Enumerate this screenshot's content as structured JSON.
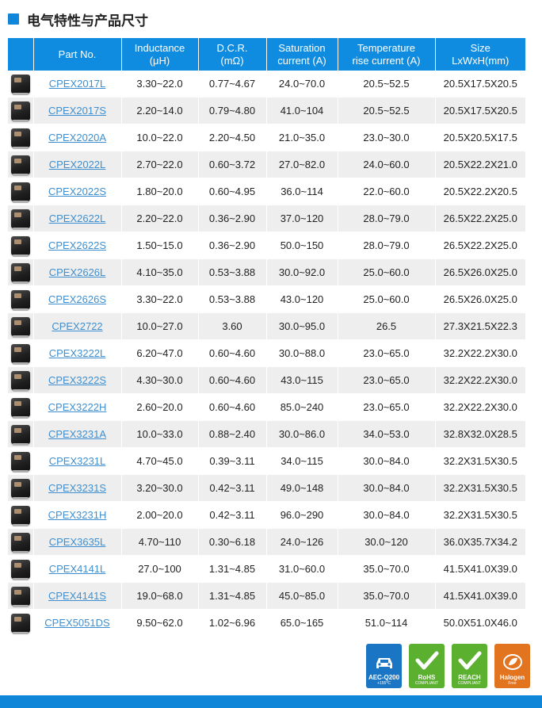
{
  "page": {
    "title": "电气特性与产品尺寸"
  },
  "table": {
    "headers": [
      "",
      "Part No.",
      "Inductance\n(μH)",
      "D.C.R.\n(mΩ)",
      "Saturation\ncurrent (A)",
      "Temperature\nrise current (A)",
      "Size\nLxWxH(mm)"
    ],
    "rows": [
      [
        "CPEX2017L",
        "3.30~22.0",
        "0.77~4.67",
        "24.0~70.0",
        "20.5~52.5",
        "20.5X17.5X20.5"
      ],
      [
        "CPEX2017S",
        "2.20~14.0",
        "0.79~4.80",
        "41.0~104",
        "20.5~52.5",
        "20.5X17.5X20.5"
      ],
      [
        "CPEX2020A",
        "10.0~22.0",
        "2.20~4.50",
        "21.0~35.0",
        "23.0~30.0",
        "20.5X20.5X17.5"
      ],
      [
        "CPEX2022L",
        "2.70~22.0",
        "0.60~3.72",
        "27.0~82.0",
        "24.0~60.0",
        "20.5X22.2X21.0"
      ],
      [
        "CPEX2022S",
        "1.80~20.0",
        "0.60~4.95",
        "36.0~114",
        "22.0~60.0",
        "20.5X22.2X20.5"
      ],
      [
        "CPEX2622L",
        "2.20~22.0",
        "0.36~2.90",
        "37.0~120",
        "28.0~79.0",
        "26.5X22.2X25.0"
      ],
      [
        "CPEX2622S",
        "1.50~15.0",
        "0.36~2.90",
        "50.0~150",
        "28.0~79.0",
        "26.5X22.2X25.0"
      ],
      [
        "CPEX2626L",
        "4.10~35.0",
        "0.53~3.88",
        "30.0~92.0",
        "25.0~60.0",
        "26.5X26.0X25.0"
      ],
      [
        "CPEX2626S",
        "3.30~22.0",
        "0.53~3.88",
        "43.0~120",
        "25.0~60.0",
        "26.5X26.0X25.0"
      ],
      [
        "CPEX2722",
        "10.0~27.0",
        "3.60",
        "30.0~95.0",
        "26.5",
        "27.3X21.5X22.3"
      ],
      [
        "CPEX3222L",
        "6.20~47.0",
        "0.60~4.60",
        "30.0~88.0",
        "23.0~65.0",
        "32.2X22.2X30.0"
      ],
      [
        "CPEX3222S",
        "4.30~30.0",
        "0.60~4.60",
        "43.0~115",
        "23.0~65.0",
        "32.2X22.2X30.0"
      ],
      [
        "CPEX3222H",
        "2.60~20.0",
        "0.60~4.60",
        "85.0~240",
        "23.0~65.0",
        "32.2X22.2X30.0"
      ],
      [
        "CPEX3231A",
        "10.0~33.0",
        "0.88~2.40",
        "30.0~86.0",
        "34.0~53.0",
        "32.8X32.0X28.5"
      ],
      [
        "CPEX3231L",
        "4.70~45.0",
        "0.39~3.11",
        "34.0~115",
        "30.0~84.0",
        "32.2X31.5X30.5"
      ],
      [
        "CPEX3231S",
        "3.20~30.0",
        "0.42~3.11",
        "49.0~148",
        "30.0~84.0",
        "32.2X31.5X30.5"
      ],
      [
        "CPEX3231H",
        "2.00~20.0",
        "0.42~3.11",
        "96.0~290",
        "30.0~84.0",
        "32.2X31.5X30.5"
      ],
      [
        "CPEX3635L",
        "4.70~110",
        "0.30~6.18",
        "24.0~126",
        "30.0~120",
        "36.0X35.7X34.2"
      ],
      [
        "CPEX4141L",
        "27.0~100",
        "1.31~4.85",
        "31.0~60.0",
        "35.0~70.0",
        "41.5X41.0X39.0"
      ],
      [
        "CPEX4141S",
        "19.0~68.0",
        "1.31~4.85",
        "45.0~85.0",
        "35.0~70.0",
        "41.5X41.0X39.0"
      ],
      [
        "CPEX5051DS",
        "9.50~62.0",
        "1.02~6.96",
        "65.0~165",
        "51.0~114",
        "50.0X51.0X46.0"
      ]
    ]
  },
  "badges": [
    {
      "name": "aec-q200-badge",
      "line1": "AEC-Q200",
      "line2": "+155°C",
      "color": "#1a76c5",
      "icon": "car-icon"
    },
    {
      "name": "rohs-badge",
      "line1": "RoHS",
      "line2": "COMPLIANT",
      "color": "#5bb030",
      "icon": "check-icon"
    },
    {
      "name": "reach-badge",
      "line1": "REACH",
      "line2": "COMPLIANT",
      "color": "#5bb030",
      "icon": "check-icon"
    },
    {
      "name": "halogen-free-badge",
      "line1": "Halogen",
      "line2": "Free",
      "color": "#e2731f",
      "icon": "leaf-icon"
    }
  ],
  "colors": {
    "accent": "#0f86d8",
    "header_bg": "#0f8ce0",
    "link": "#3f8fd0",
    "row_alt": "#eeeeee"
  }
}
